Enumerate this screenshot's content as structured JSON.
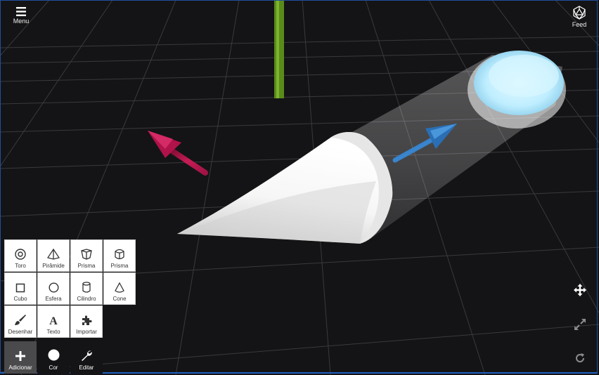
{
  "top": {
    "menu_label": "Menu",
    "feed_label": "Feed"
  },
  "palette": {
    "items": [
      {
        "label": "Toro",
        "icon": "torus-icon"
      },
      {
        "label": "Pirâmide",
        "icon": "pyramid-icon"
      },
      {
        "label": "Prisma",
        "icon": "prism-hex-icon"
      },
      {
        "label": "Prisma",
        "icon": "prism-cylinder-icon"
      },
      {
        "label": "Cubo",
        "icon": "cube-icon"
      },
      {
        "label": "Esfera",
        "icon": "sphere-icon"
      },
      {
        "label": "Cilindro",
        "icon": "cylinder-icon"
      },
      {
        "label": "Cone",
        "icon": "cone-icon"
      },
      {
        "label": "Desenhar",
        "icon": "brush-icon"
      },
      {
        "label": "Texto",
        "icon": "text-icon"
      },
      {
        "label": "Importar",
        "icon": "puzzle-icon"
      }
    ]
  },
  "bottom": {
    "add_label": "Adicionar",
    "color_label": "Cor",
    "edit_label": "Editar"
  },
  "colors": {
    "background": "#141416",
    "grid": "#3a3a3e",
    "axis_y": "#5a8a1c",
    "axis_x": "#b0124a",
    "axis_z": "#2a6fb5",
    "active_button": "#4a4a4c",
    "frame": "#1f5fbf"
  }
}
